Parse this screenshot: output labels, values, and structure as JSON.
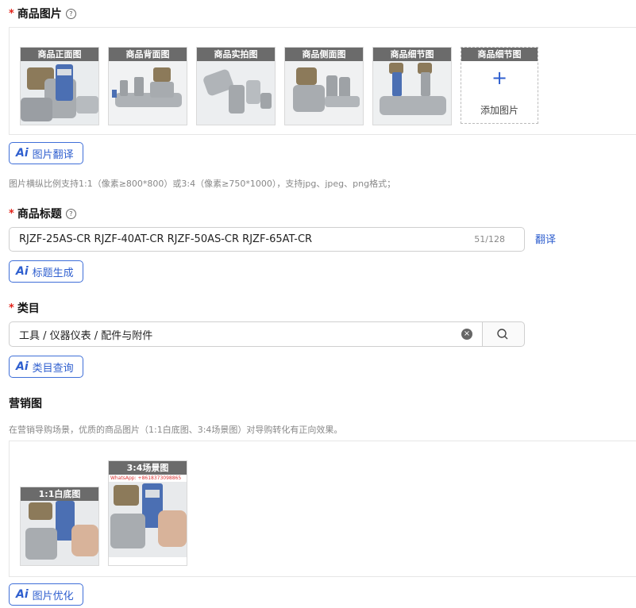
{
  "product_images": {
    "label": "商品图片",
    "items": [
      {
        "label": "商品正面图"
      },
      {
        "label": "商品背面图"
      },
      {
        "label": "商品实拍图"
      },
      {
        "label": "商品侧面图"
      },
      {
        "label": "商品细节图"
      }
    ],
    "add_slot_label": "商品细节图",
    "add_text": "添加图片",
    "translate_button": "图片翻译",
    "hint": "图片横纵比例支持1:1（像素≥800*800）或3:4（像素≥750*1000），支持jpg、jpeg、png格式；"
  },
  "title_field": {
    "label": "商品标题",
    "value": "RJZF-25AS-CR RJZF-40AT-CR RJZF-50AS-CR RJZF-65AT-CR",
    "counter": "51/128",
    "translate_link": "翻译",
    "generate_button": "标题生成"
  },
  "category": {
    "label": "类目",
    "value": "工具 / 仪器仪表 / 配件与附件",
    "query_button": "类目查询"
  },
  "marketing": {
    "label": "营销图",
    "hint": "在营销导购场景，优质的商品图片（1:1白底图、3:4场景图）对导购转化有正向效果。",
    "items": [
      {
        "label": "1:1白底图"
      },
      {
        "label": "3:4场景图"
      }
    ],
    "watermark": "WhatsApp: +8618373098865",
    "optimize_button": "图片优化"
  },
  "ai_badge": "Ai"
}
